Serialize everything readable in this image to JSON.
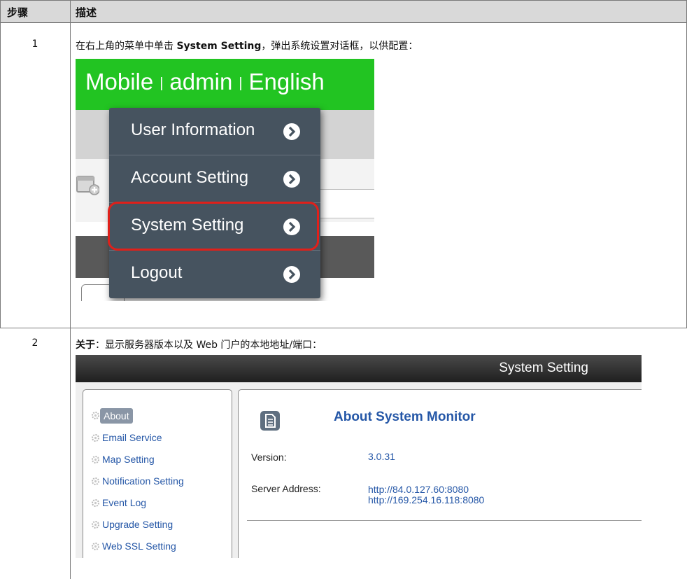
{
  "table": {
    "header": {
      "step": "步骤",
      "description": "描述"
    },
    "rows": [
      {
        "step": "1",
        "desc_before": "在右上角的菜单中单击 ",
        "desc_bold": "System Setting",
        "desc_after": "，弹出系统设置对话框，以供配置："
      },
      {
        "step": "2",
        "desc_bold": "关于",
        "desc_after": "：显示服务器版本以及 Web 门户的本地地址/端口："
      }
    ]
  },
  "screenshot1": {
    "topbar": {
      "mobile": "Mobile",
      "separator": "|",
      "admin": "admin",
      "language": "English"
    },
    "menu_items": [
      {
        "label": "User Information",
        "icon": "chevron-right-circle-icon"
      },
      {
        "label": "Account Setting",
        "icon": "chevron-right-circle-icon"
      },
      {
        "label": "System Setting",
        "icon": "chevron-right-circle-icon",
        "highlighted": true
      },
      {
        "label": "Logout",
        "icon": "chevron-right-circle-icon"
      }
    ],
    "colors": {
      "topbar": "#22c422",
      "menu_bg": "#46535f",
      "highlight": "#e0201a"
    }
  },
  "screenshot2": {
    "title": "System Setting",
    "sidebar_items": [
      {
        "label": "About",
        "active": true
      },
      {
        "label": "Email Service"
      },
      {
        "label": "Map Setting"
      },
      {
        "label": "Notification Setting"
      },
      {
        "label": "Event Log"
      },
      {
        "label": "Upgrade Setting"
      },
      {
        "label": "Web SSL Setting"
      }
    ],
    "about": {
      "title": "About System Monitor",
      "version_label": "Version:",
      "version_value": "3.0.31",
      "server_label": "Server Address:",
      "server_value_1": "http://84.0.127.60:8080",
      "server_value_2": "http://169.254.16.118:8080"
    },
    "colors": {
      "link": "#2557a7",
      "active_item": "#8a96a6"
    }
  }
}
